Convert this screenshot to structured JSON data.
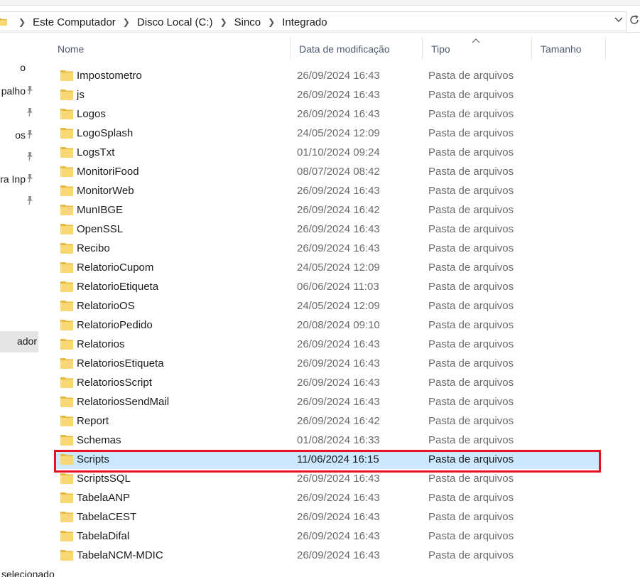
{
  "address_bar": {
    "crumbs": [
      "Este Computador",
      "Disco Local (C:)",
      "Sinco",
      "Integrado"
    ]
  },
  "nav_pane": {
    "items": [
      {
        "label": "o",
        "pinned": false
      },
      {
        "label": "palho",
        "pinned": true
      },
      {
        "label": "",
        "pinned": true
      },
      {
        "label": "os",
        "pinned": true
      },
      {
        "label": "",
        "pinned": true
      },
      {
        "label": "ra Inp",
        "pinned": true
      },
      {
        "label": "",
        "pinned": true
      }
    ],
    "selected_label": "ador"
  },
  "columns": {
    "name": "Nome",
    "date": "Data de modificação",
    "type": "Tipo",
    "size": "Tamanho",
    "sort_indicator": "^"
  },
  "files": [
    {
      "name": "Impostometro",
      "date": "26/09/2024 16:43",
      "type": "Pasta de arquivos"
    },
    {
      "name": "js",
      "date": "26/09/2024 16:43",
      "type": "Pasta de arquivos"
    },
    {
      "name": "Logos",
      "date": "26/09/2024 16:43",
      "type": "Pasta de arquivos"
    },
    {
      "name": "LogoSplash",
      "date": "24/05/2024 12:09",
      "type": "Pasta de arquivos"
    },
    {
      "name": "LogsTxt",
      "date": "01/10/2024 09:24",
      "type": "Pasta de arquivos"
    },
    {
      "name": "MonitoriFood",
      "date": "08/07/2024 08:42",
      "type": "Pasta de arquivos"
    },
    {
      "name": "MonitorWeb",
      "date": "26/09/2024 16:43",
      "type": "Pasta de arquivos"
    },
    {
      "name": "MunIBGE",
      "date": "26/09/2024 16:42",
      "type": "Pasta de arquivos"
    },
    {
      "name": "OpenSSL",
      "date": "26/09/2024 16:43",
      "type": "Pasta de arquivos"
    },
    {
      "name": "Recibo",
      "date": "26/09/2024 16:43",
      "type": "Pasta de arquivos"
    },
    {
      "name": "RelatorioCupom",
      "date": "24/05/2024 12:09",
      "type": "Pasta de arquivos"
    },
    {
      "name": "RelatorioEtiqueta",
      "date": "06/06/2024 11:03",
      "type": "Pasta de arquivos"
    },
    {
      "name": "RelatorioOS",
      "date": "24/05/2024 12:09",
      "type": "Pasta de arquivos"
    },
    {
      "name": "RelatorioPedido",
      "date": "20/08/2024 09:10",
      "type": "Pasta de arquivos"
    },
    {
      "name": "Relatorios",
      "date": "26/09/2024 16:43",
      "type": "Pasta de arquivos"
    },
    {
      "name": "RelatoriosEtiqueta",
      "date": "26/09/2024 16:43",
      "type": "Pasta de arquivos"
    },
    {
      "name": "RelatoriosScript",
      "date": "26/09/2024 16:43",
      "type": "Pasta de arquivos"
    },
    {
      "name": "RelatoriosSendMail",
      "date": "26/09/2024 16:43",
      "type": "Pasta de arquivos"
    },
    {
      "name": "Report",
      "date": "26/09/2024 16:42",
      "type": "Pasta de arquivos"
    },
    {
      "name": "Schemas",
      "date": "01/08/2024 16:33",
      "type": "Pasta de arquivos"
    },
    {
      "name": "Scripts",
      "date": "11/06/2024 16:15",
      "type": "Pasta de arquivos",
      "selected": true
    },
    {
      "name": "ScriptsSQL",
      "date": "26/09/2024 16:43",
      "type": "Pasta de arquivos"
    },
    {
      "name": "TabelaANP",
      "date": "26/09/2024 16:43",
      "type": "Pasta de arquivos"
    },
    {
      "name": "TabelaCEST",
      "date": "26/09/2024 16:43",
      "type": "Pasta de arquivos"
    },
    {
      "name": "TabelaDifal",
      "date": "26/09/2024 16:43",
      "type": "Pasta de arquivos"
    },
    {
      "name": "TabelaNCM-MDIC",
      "date": "26/09/2024 16:43",
      "type": "Pasta de arquivos"
    }
  ],
  "status_bar": {
    "text": "selecionado"
  },
  "colors": {
    "selection": "#cce8ff",
    "highlight_border": "#e81123",
    "folder": "#f8d775"
  }
}
